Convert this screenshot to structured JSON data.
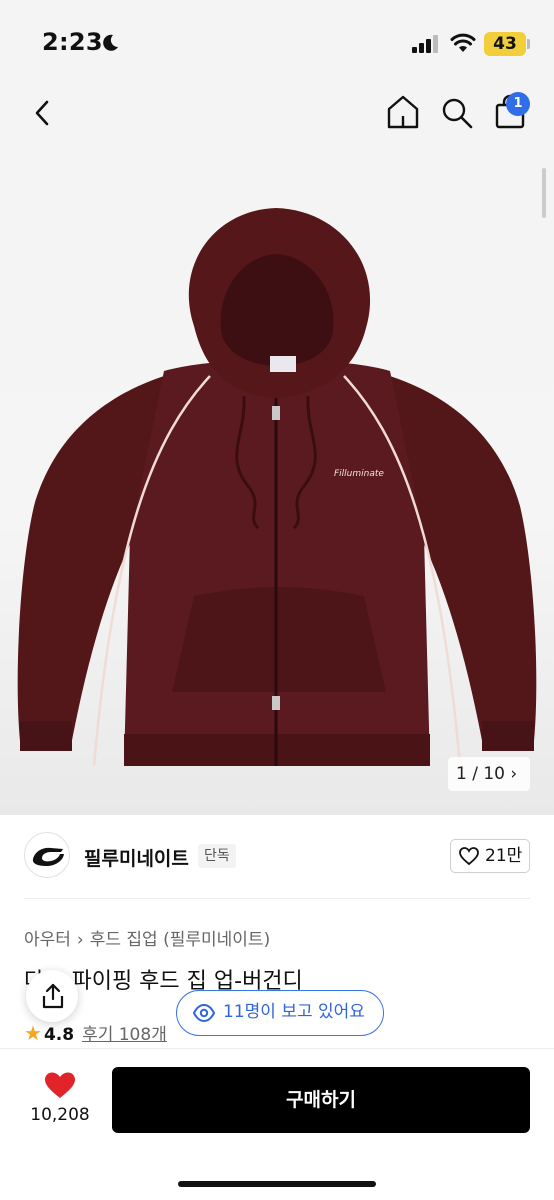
{
  "status_bar": {
    "time": "2:23",
    "battery": "43"
  },
  "nav": {
    "cart_count": "1"
  },
  "gallery": {
    "counter": "1 / 10 ›",
    "print_text": "Filluminate"
  },
  "brand": {
    "name": "필루미네이트",
    "badge": "단독",
    "likes": "21만"
  },
  "breadcrumb": {
    "category": "아우터",
    "separator": "›",
    "subcategory": "후드 집업 (필루미네이트)"
  },
  "product": {
    "title": "다크 파이핑 후드 집 업-버건디",
    "rating": "4.8",
    "reviews": "후기 108개"
  },
  "viewers": {
    "text": "11명이 보고 있어요"
  },
  "bottom": {
    "wish_count": "10,208",
    "buy_label": "구매하기"
  },
  "colors": {
    "accent": "#2f66d9",
    "heart": "#e0242a",
    "product": "#5b1a1f"
  }
}
